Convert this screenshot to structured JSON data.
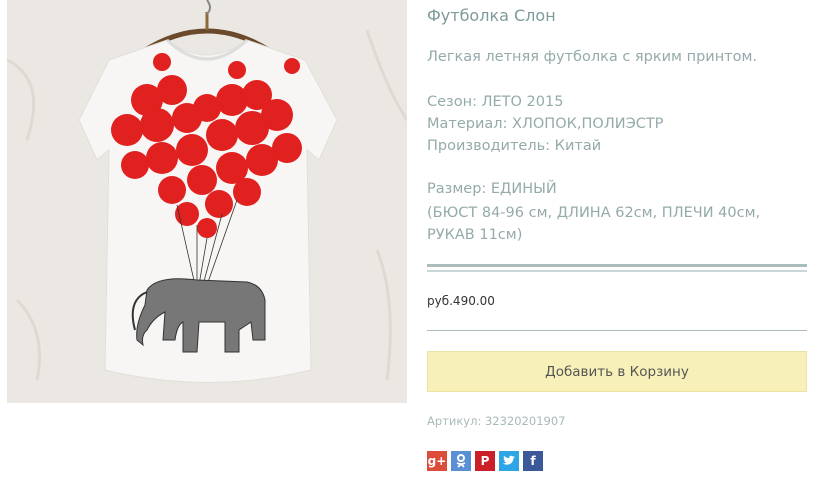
{
  "product": {
    "title": "Футболка Слон",
    "description": "Легкая летняя футболка с ярким принтом.",
    "specs": {
      "season": "Сезон: ЛЕТО 2015",
      "material": "Материал: ХЛОПОК,ПОЛИЭСТР",
      "manufacturer": "Производитель: Китай",
      "size": "Размер: ЕДИНЫЙ",
      "dimensions_1": "(БЮСТ 84-96 см, ДЛИНА 62см, ПЛЕЧИ 40см,",
      "dimensions_2": "РУКАВ 11см)"
    },
    "price": "руб.490.00",
    "add_to_cart_label": "Добавить в Корзину",
    "sku": "Артикул: 32320201907"
  },
  "share": {
    "google": "g+",
    "odnoklassniki": "ok",
    "pinterest": "P",
    "twitter": "t",
    "facebook": "f"
  },
  "colors": {
    "google": "#dd4b39",
    "odnoklassniki": "#5a8fd6",
    "pinterest": "#cb2027",
    "twitter": "#2ea6e6",
    "facebook": "#3b5998",
    "button": "#f7f0b8"
  }
}
